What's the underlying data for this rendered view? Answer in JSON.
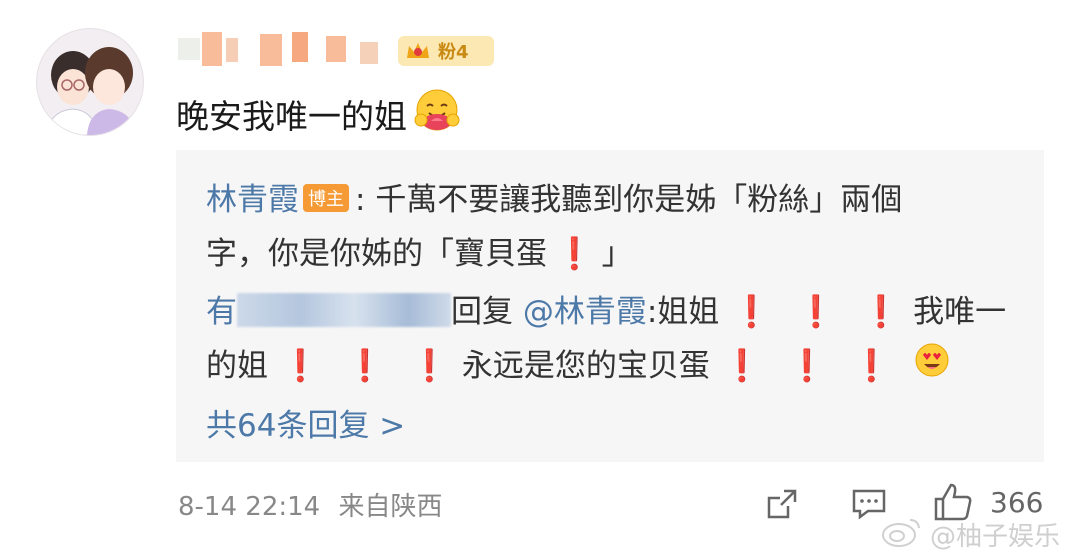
{
  "comment": {
    "fan_level": "粉4",
    "text": "晚安我唯一的姐",
    "emoji": "hugging-face"
  },
  "reply_box": {
    "author_reply": {
      "name": "林青霞",
      "badge": "博主",
      "sep": ":",
      "line1": "千萬不要讓我聽到你是姊「粉絲」兩個",
      "line2_a": "字，你是你姊的「寶貝蛋",
      "line2_b": "」"
    },
    "fan_reply": {
      "name_visible": "有",
      "reply_word": "回复",
      "mention": "@林青霞",
      "line1_a": ":姐姐",
      "line1_b": "我唯一",
      "line2_a": "的姐",
      "line2_b": "永远是您的宝贝蛋"
    },
    "exclaim": "❗",
    "more_replies": "共64条回复 >"
  },
  "footer": {
    "date": "8-14 22:14",
    "source": "来自陕西",
    "like_count": "366"
  },
  "watermark": "@柚子娱乐",
  "colors": {
    "link_blue": "#4d79a8",
    "badge_orange": "#f59a34",
    "exclaim_red": "#e0191b"
  }
}
